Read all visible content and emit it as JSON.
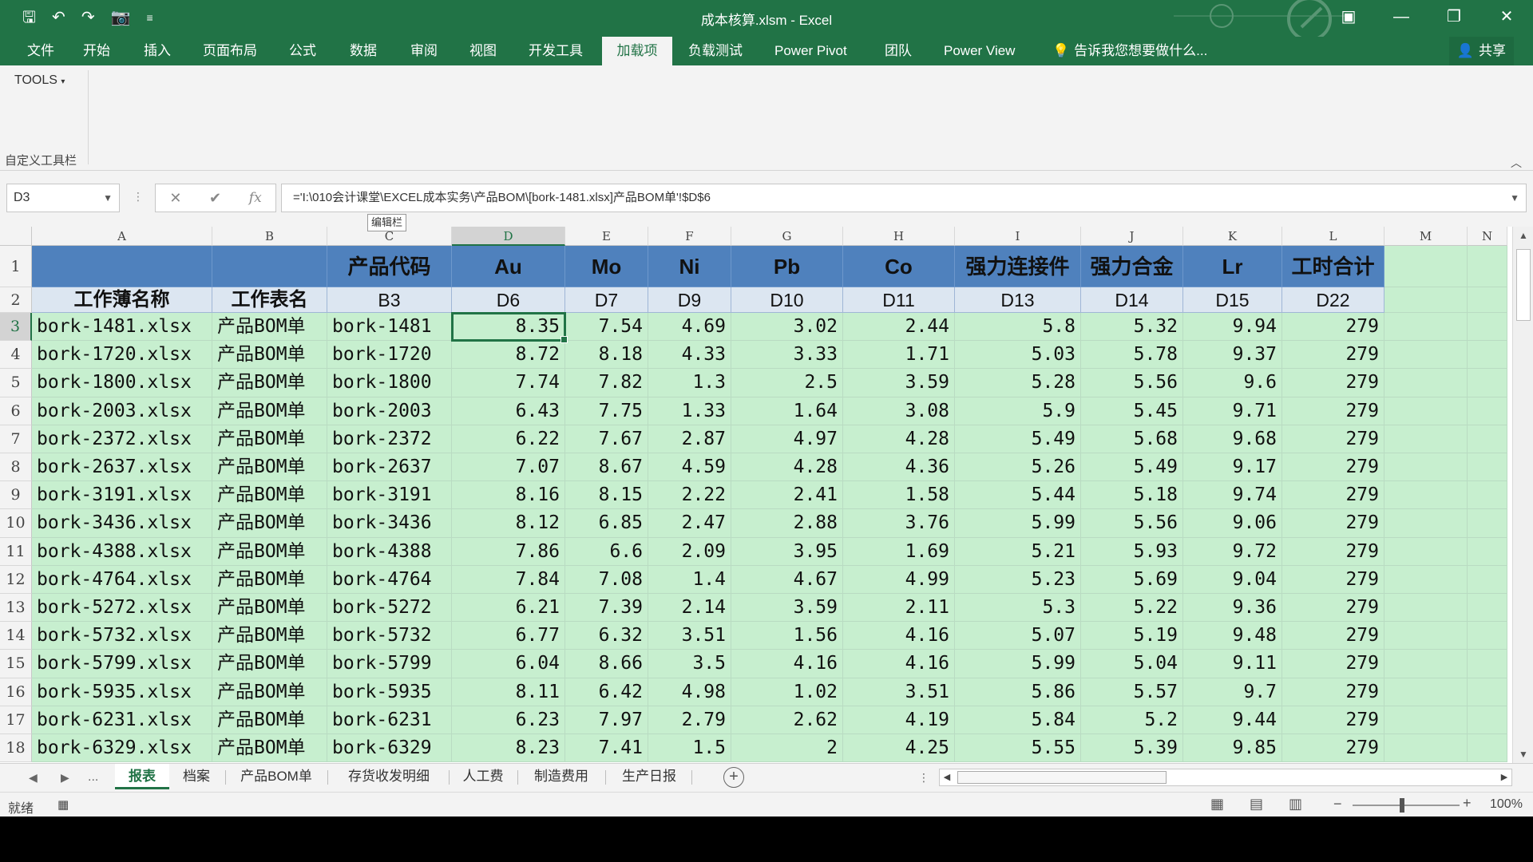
{
  "window": {
    "title": "成本核算.xlsm - Excel",
    "qat_icons": [
      "save-icon",
      "undo-icon",
      "redo-icon",
      "camera-icon",
      "customize-icon"
    ],
    "controls": [
      "ribbon-display-icon",
      "minimize-icon",
      "restore-icon",
      "close-icon"
    ]
  },
  "ribbon_tabs": [
    {
      "label": "文件"
    },
    {
      "label": "开始"
    },
    {
      "label": "插入"
    },
    {
      "label": "页面布局"
    },
    {
      "label": "公式"
    },
    {
      "label": "数据"
    },
    {
      "label": "审阅"
    },
    {
      "label": "视图"
    },
    {
      "label": "开发工具"
    },
    {
      "label": "加载项"
    },
    {
      "label": "负载测试"
    },
    {
      "label": "Power Pivot"
    },
    {
      "label": "团队"
    },
    {
      "label": "Power View"
    },
    {
      "label": "告诉我您想要做什么..."
    }
  ],
  "active_tab": "加载项",
  "share_label": "共享",
  "ribbon": {
    "tools_label": "TOOLS",
    "group_label": "自定义工具栏"
  },
  "formula_bar": {
    "name_box": "D3",
    "formula": "='I:\\010会计课堂\\EXCEL成本实务\\产品BOM\\[bork-1481.xlsx]产品BOM单'!$D$6",
    "tooltip": "编辑栏"
  },
  "columns": [
    "A",
    "B",
    "C",
    "D",
    "E",
    "F",
    "G",
    "H",
    "I",
    "J",
    "K",
    "L",
    "M",
    "N"
  ],
  "selected_column": "D",
  "header_row1": [
    "",
    "",
    "产品代码",
    "Au",
    "Mo",
    "Ni",
    "Pb",
    "Co",
    "强力连接件",
    "强力合金",
    "Lr",
    "工时合计"
  ],
  "header_row2": [
    "工作薄名称",
    "工作表名",
    "B3",
    "D6",
    "D7",
    "D9",
    "D10",
    "D11",
    "D13",
    "D14",
    "D15",
    "D22"
  ],
  "row_numbers": [
    "1",
    "2",
    "3",
    "4",
    "5",
    "6",
    "7",
    "8",
    "9",
    "10",
    "11",
    "12",
    "13",
    "14",
    "15",
    "16",
    "17",
    "18"
  ],
  "selected_row": "3",
  "data_rows": [
    [
      "bork-1481.xlsx",
      "产品BOM单",
      "bork-1481",
      "8.35",
      "7.54",
      "4.69",
      "3.02",
      "2.44",
      "5.8",
      "5.32",
      "9.94",
      "279"
    ],
    [
      "bork-1720.xlsx",
      "产品BOM单",
      "bork-1720",
      "8.72",
      "8.18",
      "4.33",
      "3.33",
      "1.71",
      "5.03",
      "5.78",
      "9.37",
      "279"
    ],
    [
      "bork-1800.xlsx",
      "产品BOM单",
      "bork-1800",
      "7.74",
      "7.82",
      "1.3",
      "2.5",
      "3.59",
      "5.28",
      "5.56",
      "9.6",
      "279"
    ],
    [
      "bork-2003.xlsx",
      "产品BOM单",
      "bork-2003",
      "6.43",
      "7.75",
      "1.33",
      "1.64",
      "3.08",
      "5.9",
      "5.45",
      "9.71",
      "279"
    ],
    [
      "bork-2372.xlsx",
      "产品BOM单",
      "bork-2372",
      "6.22",
      "7.67",
      "2.87",
      "4.97",
      "4.28",
      "5.49",
      "5.68",
      "9.68",
      "279"
    ],
    [
      "bork-2637.xlsx",
      "产品BOM单",
      "bork-2637",
      "7.07",
      "8.67",
      "4.59",
      "4.28",
      "4.36",
      "5.26",
      "5.49",
      "9.17",
      "279"
    ],
    [
      "bork-3191.xlsx",
      "产品BOM单",
      "bork-3191",
      "8.16",
      "8.15",
      "2.22",
      "2.41",
      "1.58",
      "5.44",
      "5.18",
      "9.74",
      "279"
    ],
    [
      "bork-3436.xlsx",
      "产品BOM单",
      "bork-3436",
      "8.12",
      "6.85",
      "2.47",
      "2.88",
      "3.76",
      "5.99",
      "5.56",
      "9.06",
      "279"
    ],
    [
      "bork-4388.xlsx",
      "产品BOM单",
      "bork-4388",
      "7.86",
      "6.6",
      "2.09",
      "3.95",
      "1.69",
      "5.21",
      "5.93",
      "9.72",
      "279"
    ],
    [
      "bork-4764.xlsx",
      "产品BOM单",
      "bork-4764",
      "7.84",
      "7.08",
      "1.4",
      "4.67",
      "4.99",
      "5.23",
      "5.69",
      "9.04",
      "279"
    ],
    [
      "bork-5272.xlsx",
      "产品BOM单",
      "bork-5272",
      "6.21",
      "7.39",
      "2.14",
      "3.59",
      "2.11",
      "5.3",
      "5.22",
      "9.36",
      "279"
    ],
    [
      "bork-5732.xlsx",
      "产品BOM单",
      "bork-5732",
      "6.77",
      "6.32",
      "3.51",
      "1.56",
      "4.16",
      "5.07",
      "5.19",
      "9.48",
      "279"
    ],
    [
      "bork-5799.xlsx",
      "产品BOM单",
      "bork-5799",
      "6.04",
      "8.66",
      "3.5",
      "4.16",
      "4.16",
      "5.99",
      "5.04",
      "9.11",
      "279"
    ],
    [
      "bork-5935.xlsx",
      "产品BOM单",
      "bork-5935",
      "8.11",
      "6.42",
      "4.98",
      "1.02",
      "3.51",
      "5.86",
      "5.57",
      "9.7",
      "279"
    ],
    [
      "bork-6231.xlsx",
      "产品BOM单",
      "bork-6231",
      "6.23",
      "7.97",
      "2.79",
      "2.62",
      "4.19",
      "5.84",
      "5.2",
      "9.44",
      "279"
    ],
    [
      "bork-6329.xlsx",
      "产品BOM单",
      "bork-6329",
      "8.23",
      "7.41",
      "1.5",
      "2",
      "4.25",
      "5.55",
      "5.39",
      "9.85",
      "279"
    ]
  ],
  "sheet_tabs": [
    {
      "label": "报表"
    },
    {
      "label": "档案"
    },
    {
      "label": "产品BOM单"
    },
    {
      "label": "存货收发明细"
    },
    {
      "label": "人工费"
    },
    {
      "label": "制造费用"
    },
    {
      "label": "生产日报"
    }
  ],
  "active_sheet": "报表",
  "sheet_overflow": "...",
  "status": {
    "ready": "就绪",
    "zoom": "100%"
  }
}
